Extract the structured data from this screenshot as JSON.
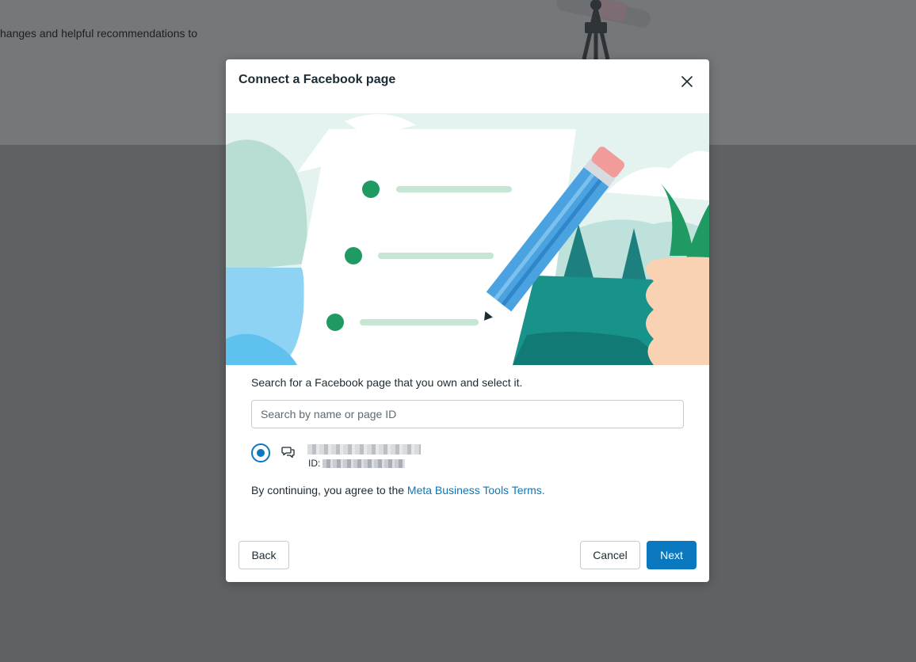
{
  "background": {
    "text": "hanges and helpful recommendations to"
  },
  "modal": {
    "title": "Connect a Facebook page",
    "instruction": "Search for a Facebook page that you own and select it.",
    "search": {
      "placeholder": "Search by name or page ID",
      "value": ""
    },
    "page_option": {
      "selected": true,
      "id_label": "ID:"
    },
    "terms": {
      "prefix": "By continuing, you agree to the ",
      "link": "Meta Business Tools Terms."
    },
    "buttons": {
      "back": "Back",
      "cancel": "Cancel",
      "next": "Next"
    }
  },
  "colors": {
    "accent": "#0a78be",
    "text": "#1c2b33"
  },
  "icons": {
    "close": "close-icon",
    "page": "chat-bubbles-icon"
  }
}
